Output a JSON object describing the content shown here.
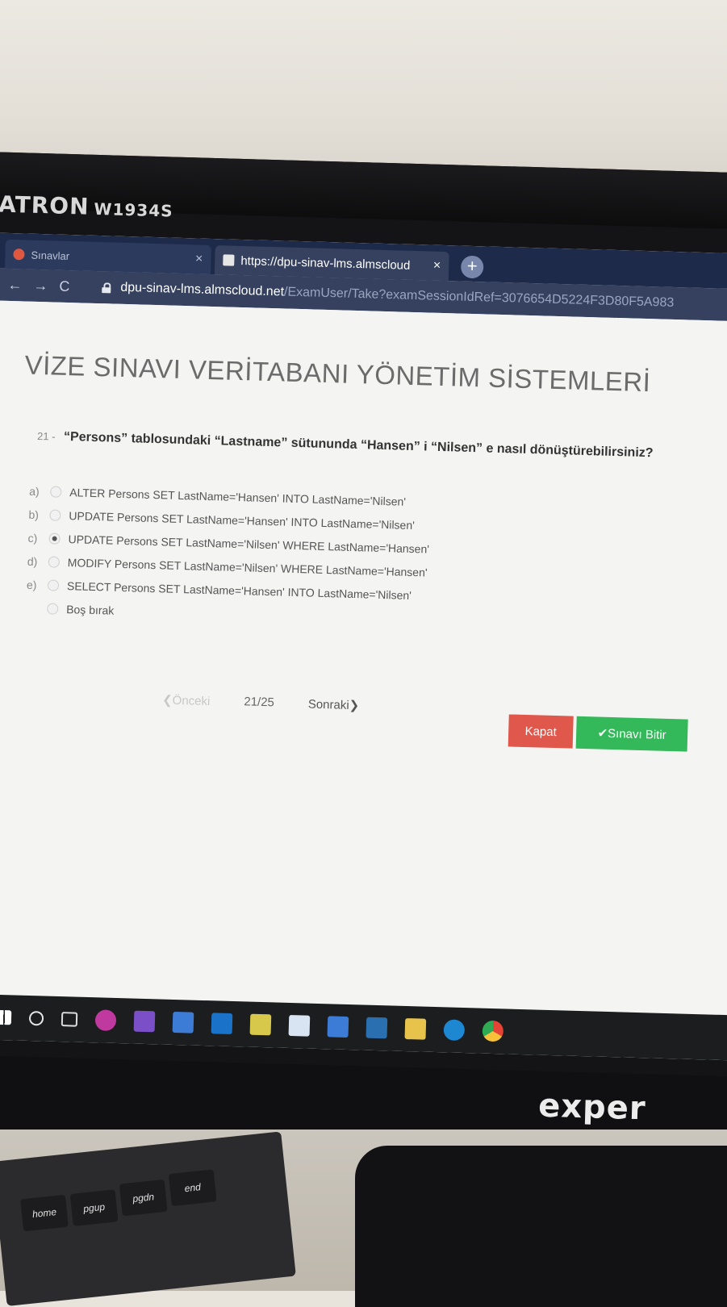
{
  "monitor": {
    "brand": "ATRON",
    "model": "W1934S",
    "bottom_logo": "exper"
  },
  "browser": {
    "tabs": [
      {
        "title": "Sınavlar",
        "close": "×",
        "active": false
      },
      {
        "title": "https://dpu-sinav-lms.almscloud",
        "close": "×",
        "active": true
      }
    ],
    "new_tab": "+",
    "nav": {
      "back": "←",
      "forward": "→",
      "reload": "C"
    },
    "url_host": "dpu-sinav-lms.almscloud.net",
    "url_path": "/ExamUser/Take?examSessionIdRef=3076654D5224F3D80F5A983"
  },
  "exam": {
    "title": "VİZE SINAVI VERİTABANI YÖNETİM SİSTEMLERİ",
    "question_number": "21 -",
    "question_text": "“Persons” tablosundaki “Lastname” sütununda “Hansen” i “Nilsen” e nasıl dönüştürebilirsiniz?",
    "options": [
      {
        "letter": "a)",
        "text": "ALTER Persons SET LastName='Hansen' INTO LastName='Nilsen'",
        "selected": false
      },
      {
        "letter": "b)",
        "text": "UPDATE Persons SET LastName='Hansen' INTO LastName='Nilsen'",
        "selected": false
      },
      {
        "letter": "c)",
        "text": "UPDATE Persons SET LastName='Nilsen' WHERE LastName='Hansen'",
        "selected": true
      },
      {
        "letter": "d)",
        "text": "MODIFY Persons SET LastName='Nilsen' WHERE LastName='Hansen'",
        "selected": false
      },
      {
        "letter": "e)",
        "text": "SELECT Persons SET LastName='Hansen' INTO LastName='Nilsen'",
        "selected": false
      }
    ],
    "blank_option": "Boş bırak",
    "pager": {
      "prev": "❮Önceki",
      "count": "21/25",
      "next": "Sonraki❯"
    },
    "buttons": {
      "close": "Kapat",
      "finish": "✔Sınavı Bitir"
    }
  },
  "taskbar": {
    "icons": [
      "windows-start-icon",
      "search-icon",
      "task-view-icon",
      "utorrent-icon",
      "visual-studio-icon",
      "people-icon",
      "outlook-icon",
      "project-icon",
      "box-icon",
      "store-icon",
      "mail-icon",
      "file-explorer-icon",
      "edge-icon",
      "chrome-icon"
    ]
  },
  "keyboard": {
    "keys": [
      "home",
      "pgup",
      "pgdn",
      "end"
    ]
  },
  "colors": {
    "close_button": "#e0574b",
    "finish_button": "#33b959",
    "browser_chrome": "#35415f"
  }
}
